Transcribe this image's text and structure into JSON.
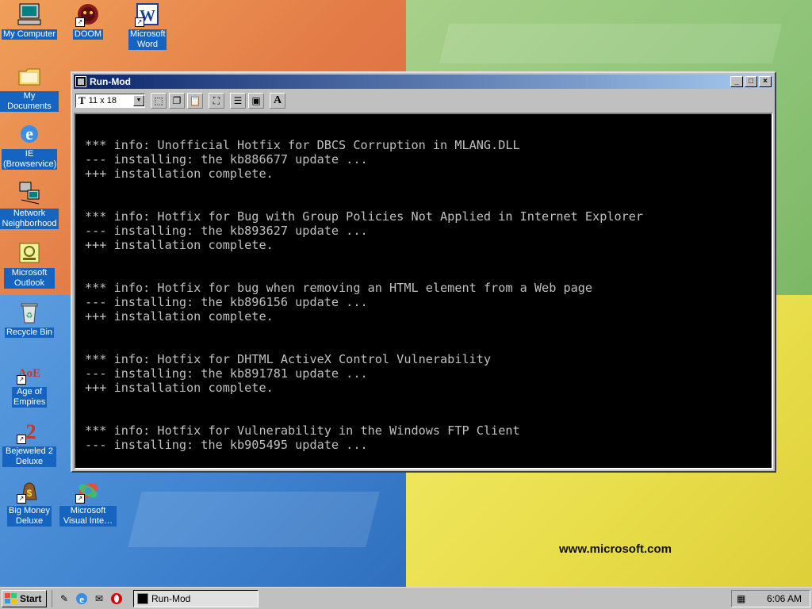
{
  "desktop": {
    "icons": [
      {
        "label": "My Computer",
        "icon": "my-computer-icon"
      },
      {
        "label": "DOOM",
        "icon": "doom-icon"
      },
      {
        "label": "Microsoft Word",
        "icon": "word-icon"
      },
      {
        "label": "My Documents",
        "icon": "folder-icon"
      },
      {
        "label": "IE (Browservice)",
        "icon": "ie-icon"
      },
      {
        "label": "Network Neighborhood",
        "icon": "network-icon"
      },
      {
        "label": "Microsoft Outlook",
        "icon": "outlook-icon"
      },
      {
        "label": "Recycle Bin",
        "icon": "recycle-bin-icon"
      },
      {
        "label": "Age of Empires",
        "icon": "age-of-empires-icon"
      },
      {
        "label": "Bejeweled 2 Deluxe",
        "icon": "bejeweled-icon"
      },
      {
        "label": "Big Money Deluxe",
        "icon": "big-money-icon"
      },
      {
        "label": "Microsoft Visual Inte…",
        "icon": "visual-interdev-icon"
      }
    ],
    "wallpaper_url": "www.microsoft.com"
  },
  "window": {
    "title": "Run-Mod",
    "font_size": "11 x 18",
    "controls": {
      "minimize": "_",
      "maximize": "□",
      "close": "×"
    }
  },
  "console": {
    "lines": [
      "*** info: Unofficial Hotfix for DBCS Corruption in MLANG.DLL",
      "--- installing: the kb886677 update ...",
      "+++ installation complete.",
      "*** info: Hotfix for Bug with Group Policies Not Applied in Internet Explorer",
      "--- installing: the kb893627 update ...",
      "+++ installation complete.",
      "*** info: Hotfix for bug when removing an HTML element from a Web page",
      "--- installing: the kb896156 update ...",
      "+++ installation complete.",
      "*** info: Hotfix for DHTML ActiveX Control Vulnerability",
      "--- installing: the kb891781 update ...",
      "+++ installation complete.",
      "*** info: Hotfix for Vulnerability in the Windows FTP Client",
      "--- installing: the kb905495 update ..."
    ]
  },
  "taskbar": {
    "start_label": "Start",
    "task_label": "Run-Mod",
    "clock": "6:06 AM"
  },
  "colors": {
    "console_text": "#c0c0c0",
    "console_bg": "#000000",
    "title_active": "#0a246a",
    "icon_label_bg": "#1565c0"
  }
}
